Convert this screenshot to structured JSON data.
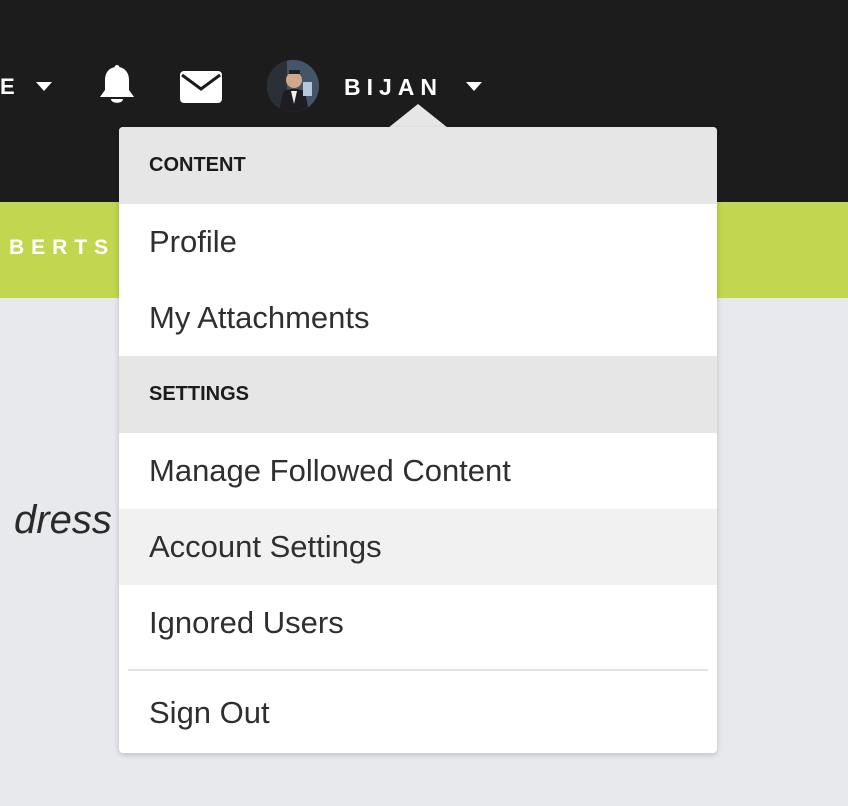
{
  "header": {
    "partial_nav_label": "E",
    "username": "BIJAN",
    "icons": [
      "chevron-down-icon",
      "bell-icon",
      "mail-icon",
      "avatar",
      "chevron-down-icon"
    ]
  },
  "subheader": {
    "partial_label": "BERTS"
  },
  "background": {
    "partial_text": "dress"
  },
  "dropdown": {
    "content_header": "CONTENT",
    "content_items": [
      {
        "label": "Profile"
      },
      {
        "label": "My Attachments"
      }
    ],
    "settings_header": "SETTINGS",
    "settings_items": [
      {
        "label": "Manage Followed Content"
      },
      {
        "label": "Account Settings"
      },
      {
        "label": "Ignored Users"
      }
    ],
    "signout_label": "Sign Out",
    "hovered_item": "Account Settings"
  },
  "colors": {
    "topbar": "#1c1c1d",
    "greenbar": "#c3d64f",
    "page_bg": "#e8e9ed",
    "section_header_bg": "#e6e6e6",
    "hover_bg": "#f1f1f1"
  }
}
